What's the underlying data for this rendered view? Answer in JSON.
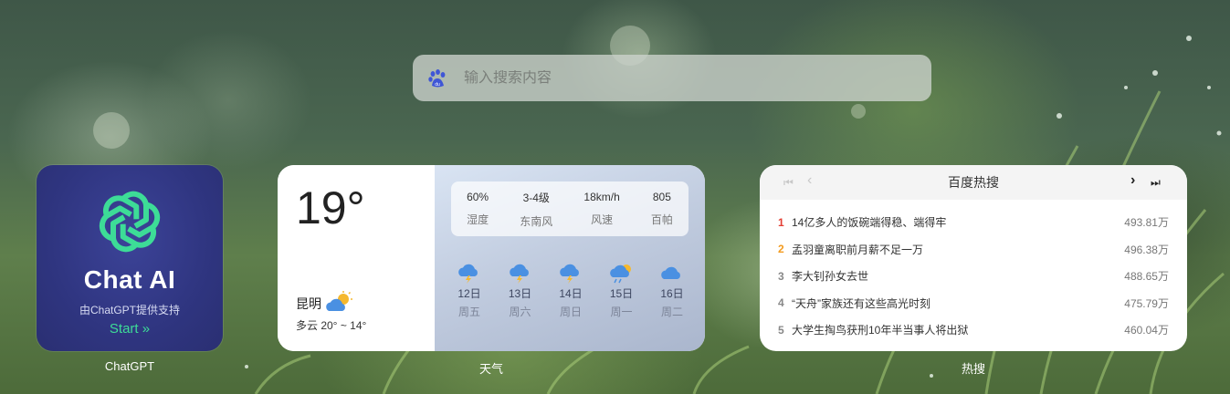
{
  "search": {
    "placeholder": "输入搜索内容",
    "engine_icon": "baidu-paw-icon"
  },
  "chatgpt": {
    "title": "Chat AI",
    "subtitle": "由ChatGPT提供支持",
    "start_label": "Start",
    "start_arrow": "»",
    "label": "ChatGPT",
    "colors": {
      "bg": "#2f3580",
      "logo": "#3ddc97",
      "start": "#3ddc97"
    }
  },
  "weather": {
    "temp": "19°",
    "city": "昆明",
    "condition": "多云 20° ~ 14°",
    "label": "天气",
    "stats": [
      {
        "value": "60%",
        "key": "湿度"
      },
      {
        "value": "3-4级",
        "key": "东南风"
      },
      {
        "value": "18km/h",
        "key": "风速"
      },
      {
        "value": "805",
        "key": "百帕"
      }
    ],
    "forecast": [
      {
        "date": "12日",
        "weekday": "周五",
        "icon": "thunder-rain-icon"
      },
      {
        "date": "13日",
        "weekday": "周六",
        "icon": "thunder-rain-icon"
      },
      {
        "date": "14日",
        "weekday": "周日",
        "icon": "thunder-rain-icon"
      },
      {
        "date": "15日",
        "weekday": "周一",
        "icon": "sun-rain-icon"
      },
      {
        "date": "16日",
        "weekday": "周二",
        "icon": "cloud-icon"
      }
    ]
  },
  "hot": {
    "title": "百度热搜",
    "label": "热搜",
    "nav": {
      "first": "⏮",
      "prev": "‹",
      "next": "›",
      "last": "⏭"
    },
    "items": [
      {
        "rank": "1",
        "title": "14亿多人的饭碗端得稳、端得牢",
        "count": "493.81万",
        "color": "#e33e33"
      },
      {
        "rank": "2",
        "title": "孟羽童离职前月薪不足一万",
        "count": "496.38万",
        "color": "#f39b1f"
      },
      {
        "rank": "3",
        "title": "李大钊孙女去世",
        "count": "488.65万",
        "color": "#888888"
      },
      {
        "rank": "4",
        "title": "“天舟”家族还有这些高光时刻",
        "count": "475.79万",
        "color": "#888888"
      },
      {
        "rank": "5",
        "title": "大学生掏鸟获刑10年半当事人将出狱",
        "count": "460.04万",
        "color": "#888888"
      }
    ]
  }
}
